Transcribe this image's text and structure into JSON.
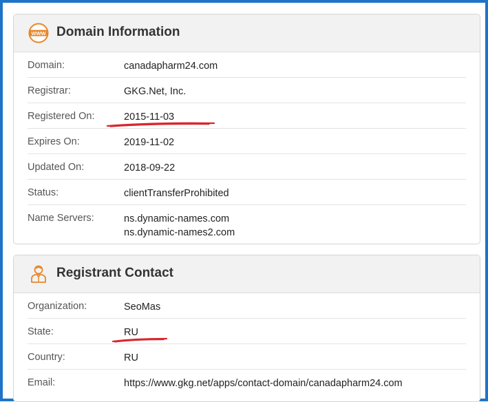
{
  "domain_info": {
    "title": "Domain Information",
    "icon": "www-globe-icon",
    "rows": [
      {
        "label": "Domain:",
        "value": "canadapharm24.com"
      },
      {
        "label": "Registrar:",
        "value": "GKG.Net, Inc."
      },
      {
        "label": "Registered On:",
        "value": "2015-11-03"
      },
      {
        "label": "Expires On:",
        "value": "2019-11-02"
      },
      {
        "label": "Updated On:",
        "value": "2018-09-22"
      },
      {
        "label": "Status:",
        "value": "clientTransferProhibited"
      },
      {
        "label": "Name Servers:",
        "values": [
          "ns.dynamic-names.com",
          "ns.dynamic-names2.com"
        ]
      }
    ]
  },
  "registrant_contact": {
    "title": "Registrant Contact",
    "icon": "person-icon",
    "rows": [
      {
        "label": "Organization:",
        "value": "SeoMas"
      },
      {
        "label": "State:",
        "value": "RU"
      },
      {
        "label": "Country:",
        "value": "RU"
      },
      {
        "label": "Email:",
        "value": "https://www.gkg.net/apps/contact-domain/canadapharm24.com"
      }
    ]
  },
  "colors": {
    "frame_border": "#1d74c8",
    "icon_accent": "#e8862a",
    "annotation_red": "#d8262c"
  }
}
